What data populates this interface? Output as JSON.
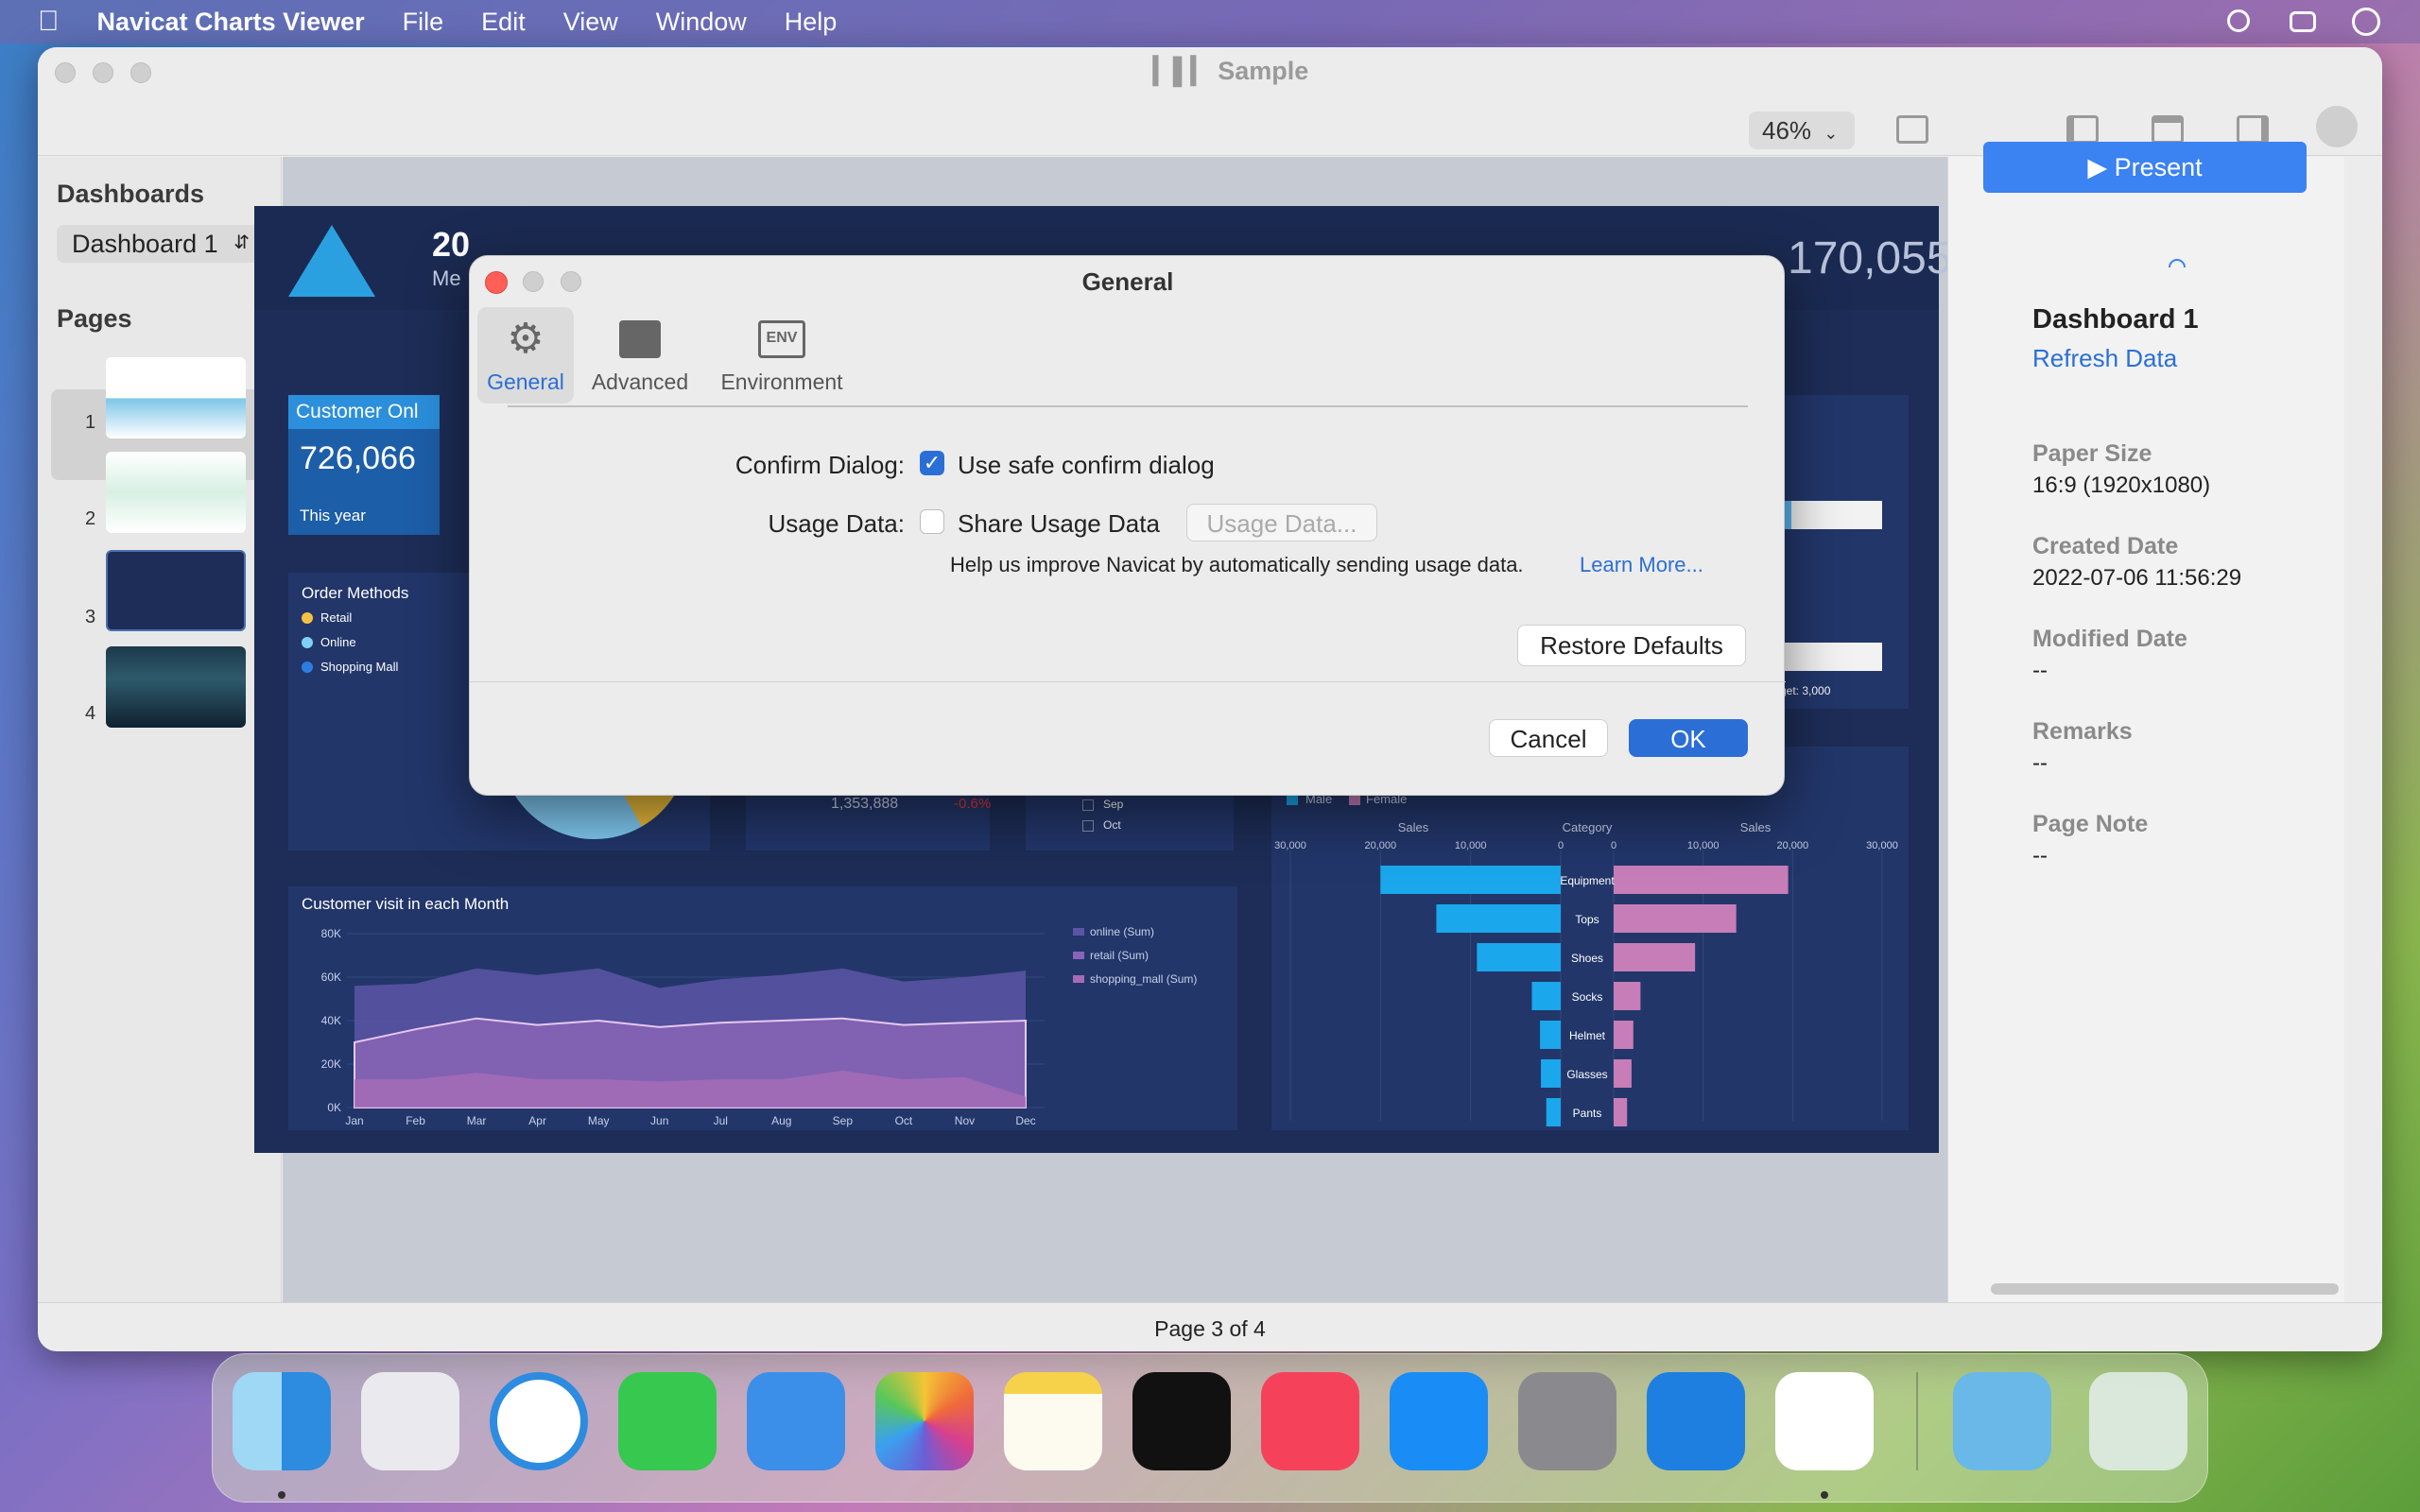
{
  "menubar": {
    "app_name": "Navicat Charts Viewer",
    "items": [
      "File",
      "Edit",
      "View",
      "Window",
      "Help"
    ]
  },
  "window": {
    "title": "Sample",
    "zoom": "46%"
  },
  "sidebar": {
    "dashboards_heading": "Dashboards",
    "dashboard_selected": "Dashboard 1",
    "pages_heading": "Pages",
    "pages": [
      "1",
      "2",
      "3",
      "4"
    ],
    "selected_page": 3
  },
  "dashboard_canvas": {
    "header_title_partial": "20",
    "header_sub_partial": "Me",
    "header_value": "170,055",
    "kpi_title_partial": "Customer Onl",
    "kpi_value": "726,066",
    "kpi_caption": "This year",
    "order_methods": {
      "title": "Order Methods",
      "legend": [
        "Retail",
        "Online",
        "Shopping Mall"
      ]
    },
    "mid_value": "1,353,888",
    "mid_delta": "-0.6%",
    "months_partial": [
      "Sep",
      "Oct"
    ],
    "target_label": "rget: 3,000",
    "gender_legend": [
      "Male",
      "Female"
    ]
  },
  "right_panel": {
    "present_label": "Present",
    "dashboard_name": "Dashboard 1",
    "refresh_label": "Refresh Data",
    "paper_size_label": "Paper Size",
    "paper_size_value": "16:9 (1920x1080)",
    "created_label": "Created Date",
    "created_value": "2022-07-06 11:56:29",
    "modified_label": "Modified Date",
    "modified_value": "--",
    "remarks_label": "Remarks",
    "remarks_value": "--",
    "page_note_label": "Page Note",
    "page_note_value": "--"
  },
  "statusbar": {
    "page_text": "Page 3 of 4"
  },
  "dialog": {
    "title": "General",
    "tabs": [
      "General",
      "Advanced",
      "Environment"
    ],
    "env_icon_text": "ENV",
    "confirm_label": "Confirm Dialog:",
    "confirm_option": "Use safe confirm dialog",
    "confirm_checked": true,
    "usage_label": "Usage Data:",
    "usage_option": "Share Usage Data",
    "usage_checked": false,
    "usage_button": "Usage Data...",
    "help_text": "Help us improve Navicat by automatically sending usage data.",
    "learn_more": "Learn More...",
    "restore_button": "Restore Defaults",
    "cancel_button": "Cancel",
    "ok_button": "OK"
  },
  "colors": {
    "accent": "#2b6fd6",
    "dashboard_bg": "#1d2d57",
    "male": "#1aa7ec",
    "female": "#c77db8",
    "area_online": "#6b5fb0",
    "area_retail": "#b06fb8"
  },
  "chart_data": [
    {
      "type": "area",
      "title": "Customer visit in each Month",
      "categories": [
        "Jan",
        "Feb",
        "Mar",
        "Apr",
        "May",
        "Jun",
        "Jul",
        "Aug",
        "Sep",
        "Oct",
        "Nov",
        "Dec"
      ],
      "series": [
        {
          "name": "online (Sum)",
          "values": [
            56000,
            57000,
            64000,
            61000,
            64000,
            55000,
            59000,
            61000,
            64000,
            58000,
            60000,
            63000
          ]
        },
        {
          "name": "retail (Sum)",
          "values": [
            30000,
            36000,
            41000,
            38000,
            40000,
            37000,
            39000,
            40000,
            41000,
            38000,
            39000,
            40000
          ]
        },
        {
          "name": "shopping_mall (Sum)",
          "values": [
            13000,
            13000,
            16000,
            13000,
            13000,
            12000,
            13000,
            13000,
            17000,
            13000,
            14000,
            5000
          ]
        }
      ],
      "yticks": [
        "0K",
        "20K",
        "40K",
        "60K",
        "80K"
      ],
      "ylim": [
        0,
        80000
      ]
    },
    {
      "type": "bar",
      "orientation": "horizontal-butterfly",
      "categories": [
        "Equipment",
        "Tops",
        "Shoes",
        "Socks",
        "Helmet",
        "Glasses",
        "Pants"
      ],
      "series": [
        {
          "name": "Male",
          "values": [
            20000,
            13800,
            9300,
            3200,
            2300,
            2200,
            1600
          ]
        },
        {
          "name": "Female",
          "values": [
            19500,
            13700,
            9100,
            3000,
            2200,
            2000,
            1500
          ]
        }
      ],
      "left_axis_label": "Sales",
      "center_axis_label": "Category",
      "right_axis_label": "Sales",
      "left_ticks": [
        "30,000",
        "20,000",
        "10,000",
        "0"
      ],
      "right_ticks": [
        "0",
        "10,000",
        "20,000",
        "30,000"
      ],
      "xlim": [
        0,
        30000
      ]
    }
  ]
}
